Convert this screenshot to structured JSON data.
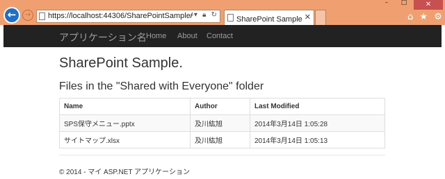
{
  "browser": {
    "window_controls": {
      "minimize": "–",
      "maximize": "□",
      "close": "✕"
    },
    "back_glyph": "←",
    "forward_glyph": "→",
    "address_bar": {
      "url": "https://localhost:44306/SharePointSample/",
      "icons": [
        "search-icon",
        "lock-icon",
        "refresh-icon"
      ]
    },
    "tab": {
      "title": "SharePoint Sample - マイ…",
      "close": "✕"
    },
    "toolbar_icons": [
      "home-icon",
      "favorites-icon",
      "settings-icon"
    ]
  },
  "navbar": {
    "brand": "アプリケーション名",
    "links": [
      "Home",
      "About",
      "Contact"
    ]
  },
  "main": {
    "heading": "SharePoint Sample.",
    "subheading": "Files in the \"Shared with Everyone\" folder",
    "table": {
      "headers": [
        "Name",
        "Author",
        "Last Modified"
      ],
      "rows": [
        [
          "SPS保守メニュー.pptx",
          "及川紘旭",
          "2014年3月14日 1:05:28"
        ],
        [
          "サイトマップ.xlsx",
          "及川紘旭",
          "2014年3月14日 1:05:13"
        ]
      ]
    }
  },
  "footer": {
    "text": "© 2014 - マイ ASP.NET アプリケーション"
  }
}
